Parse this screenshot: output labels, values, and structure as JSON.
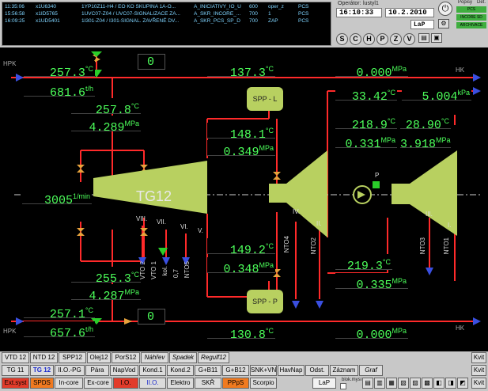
{
  "alarms": [
    {
      "time": "11:35:06",
      "id": "x1U6340",
      "text": "1YP10Z11-H4 / EO KO SKUPINA 1A-O...",
      "group": "A_INICIATIVY_IO_U",
      "code": "600",
      "user": "oper_z",
      "src": "PCS"
    },
    {
      "time": "15:56:58",
      "id": "x1ID5765",
      "text": "1UVC07-Z04 / UVC07-SIGNALIZACE ZA...",
      "group": "A_SKR_INCORE_...",
      "code": "700",
      "user": "1",
      "src": "PCS"
    },
    {
      "time": "16:09:25",
      "id": "x1UD5401",
      "text": "1I301-Z04 / I301-SIGNAL. ZAVŘENÉ DV...",
      "group": "A_SKR_PCS_SP_D",
      "code": "700",
      "user": "ZAP",
      "src": "PCS"
    }
  ],
  "status": {
    "operator_label": "Operátor:",
    "operator": "lustyl1",
    "time": "16:10:33",
    "date": "10.2.2010",
    "mode": "LaP",
    "nav": [
      "S",
      "C",
      "H",
      "P",
      "Z",
      "V"
    ],
    "popisy": "Popisy",
    "det": "Det.",
    "ind": [
      "PCS",
      "INCORE SD",
      "ARCHIVACE"
    ]
  },
  "values": {
    "t_hpk_in": "257.3",
    "f_hpk_in": "681.6",
    "t_zero_top": "0",
    "t_137": "137.3",
    "p_top_right": "0.000",
    "t_257_8": "257.8",
    "p_4_289": "4.289",
    "t_148": "148.1",
    "p_0_349": "0.349",
    "t_33": "33.42",
    "p_5_004": "5.004",
    "t_218": "218.9",
    "p_0_331": "0.331",
    "t_28": "28.90",
    "p_3_918": "3.918",
    "speed": "3005",
    "t_149": "149.2",
    "p_0_348": "0.348",
    "t_219": "219.3",
    "p_0_335": "0.335",
    "t_255": "255.3",
    "p_4_287": "4.287",
    "t_257_1": "257.1",
    "f_657": "657.6",
    "t_zero_bot": "0",
    "t_130": "130.8",
    "p_bot_right": "0.000"
  },
  "units": {
    "c": "°C",
    "th": "t/h",
    "mpa": "MPa",
    "kpa": "kPa",
    "rpm": "1/min"
  },
  "labels": {
    "hpk": "HPK",
    "hk": "HK",
    "tg": "TG12",
    "spp_l": "SPP - L",
    "spp_p": "SPP - P",
    "p": "P",
    "s8": "VIII.",
    "s7": "VII.",
    "s6": "VI.",
    "s5": "V.",
    "s4": "IV.",
    "s2": "II.",
    "s3": "III.",
    "s1": "I.",
    "nto4": "NTO4",
    "nto2": "NTO2",
    "nto3": "NTO3",
    "nto1": "NTO1",
    "vto2": "VTO 2",
    "vto1": "VTO 1",
    "kol": "kol.",
    "v07": "0,7",
    "nto5": "NTO5"
  },
  "menu": {
    "row1": [
      "VTD 12",
      "NTD 12",
      "SPP12",
      "Olej12",
      "PorS12",
      "Náhřev",
      "Spadek",
      "Regulf12"
    ],
    "row2": [
      "TG 11",
      "TG 12",
      "II.O.-PG",
      "Pára",
      "NapVod",
      "Kond.1",
      "Kond.2",
      "G+B11",
      "G+B12",
      "SNK+VN",
      "HavNap",
      "Odst.",
      "Záznam",
      "Graf"
    ],
    "row3": [
      "Ext.syst",
      "SPDS",
      "In-core",
      "Ex-core",
      "I.O.",
      "II.O.",
      "Elektro",
      "SKŘ",
      "PPpS",
      "Scorpio",
      "LaP"
    ],
    "kvit": "Kvit",
    "blok": "blok.mysi"
  }
}
